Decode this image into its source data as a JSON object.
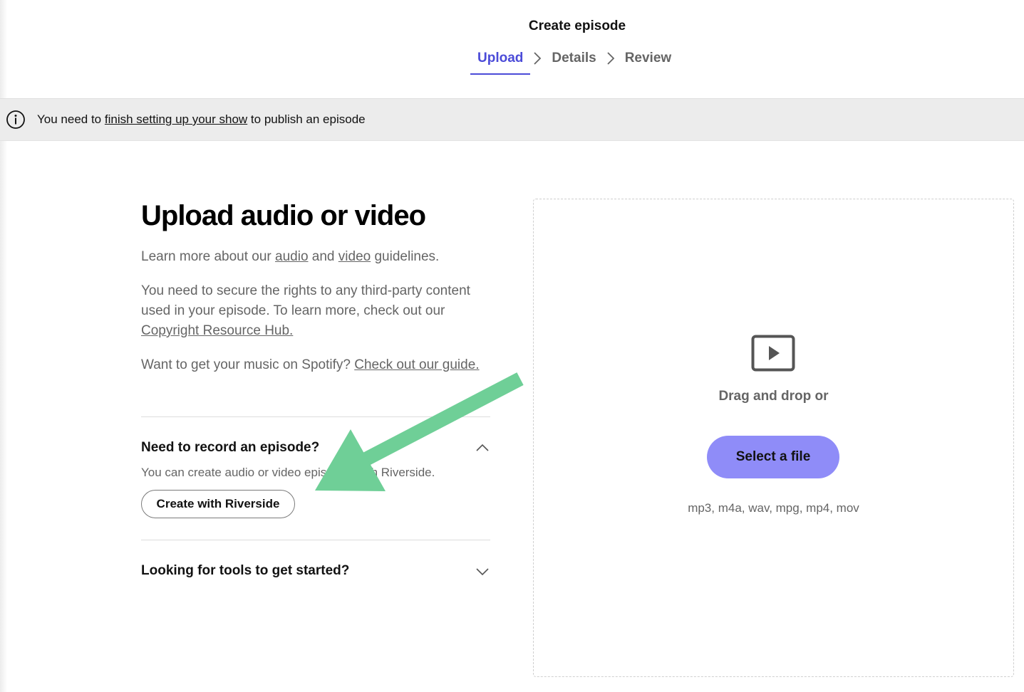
{
  "header": {
    "title": "Create episode",
    "steps": [
      {
        "label": "Upload",
        "active": true
      },
      {
        "label": "Details",
        "active": false
      },
      {
        "label": "Review",
        "active": false
      }
    ]
  },
  "banner": {
    "icon": "info-icon",
    "text_before": "You need to ",
    "link": "finish setting up your show",
    "text_after": " to publish an episode"
  },
  "main": {
    "title": "Upload audio or video",
    "guidelines": {
      "before": "Learn more about our ",
      "audio_link": "audio",
      "middle": " and ",
      "video_link": "video",
      "after": " guidelines."
    },
    "rights": {
      "text": "You need to secure the rights to any third-party content used in your episode. To learn more, check out our ",
      "link": "Copyright Resource Hub."
    },
    "music": {
      "text": "Want to get your music on Spotify? ",
      "link": "Check out our guide."
    },
    "record_section": {
      "title": "Need to record an episode?",
      "description": "You can create audio or video episodes with Riverside.",
      "button": "Create with Riverside",
      "expanded": true
    },
    "tools_section": {
      "title": "Looking for tools to get started?",
      "expanded": false
    }
  },
  "upload": {
    "icon": "video-play-icon",
    "drag_text": "Drag and drop or",
    "button": "Select a file",
    "formats": "mp3, m4a, wav, mpg, mp4, mov"
  },
  "colors": {
    "accent": "#4b4bd8",
    "button_purple": "#8f8cf8",
    "annotation_arrow": "#6fcf97"
  }
}
